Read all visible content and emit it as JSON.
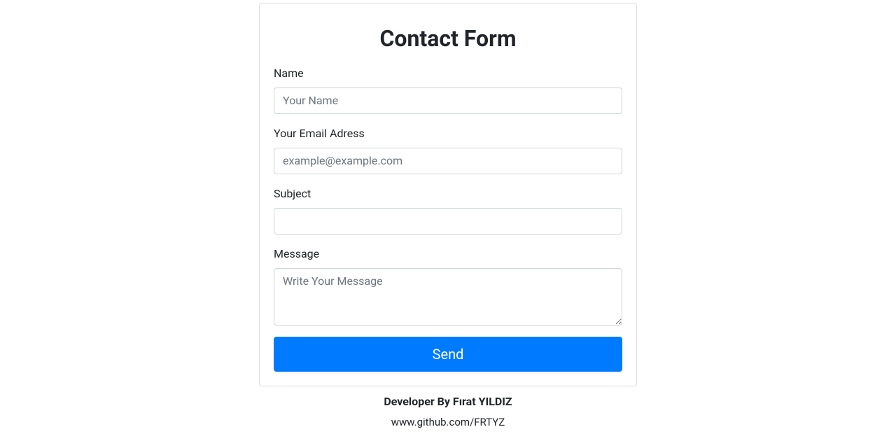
{
  "form": {
    "title": "Contact Form",
    "name": {
      "label": "Name",
      "placeholder": "Your Name",
      "value": ""
    },
    "email": {
      "label": "Your Email Adress",
      "placeholder": "example@example.com",
      "value": ""
    },
    "subject": {
      "label": "Subject",
      "placeholder": "",
      "value": ""
    },
    "message": {
      "label": "Message",
      "placeholder": "Write Your Message",
      "value": ""
    },
    "submit_label": "Send"
  },
  "footer": {
    "credit": "Developer By Fırat YILDIZ",
    "link_text": "www.github.com/FRTYZ"
  }
}
